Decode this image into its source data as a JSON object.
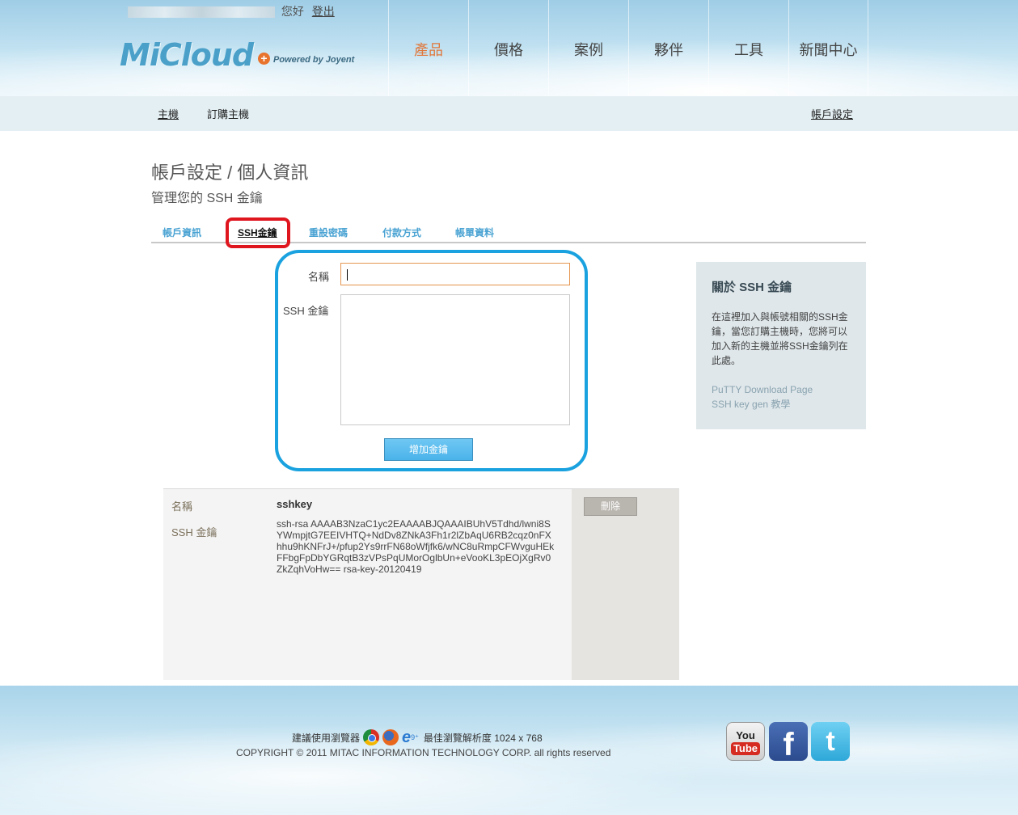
{
  "header": {
    "greeting": "您好",
    "logout": "登出",
    "logo_text": "MiCloud",
    "logo_plus": "+",
    "powered_by": "Powered by Joyent",
    "nav": [
      "產品",
      "價格",
      "案例",
      "夥伴",
      "工具",
      "新聞中心"
    ],
    "active_nav": "產品"
  },
  "subnav": {
    "hosts": "主機",
    "order_hosts": "訂購主機",
    "account_settings": "帳戶設定"
  },
  "page": {
    "title": "帳戶設定 / 個人資訊",
    "subtitle": "管理您的 SSH 金鑰"
  },
  "tabs": [
    "帳戶資訊",
    "SSH金鑰",
    "重設密碼",
    "付款方式",
    "帳單資料"
  ],
  "active_tab": "SSH金鑰",
  "form": {
    "name_label": "名稱",
    "name_value": "",
    "key_label": "SSH 金鑰",
    "key_value": "",
    "add_button": "增加金鑰"
  },
  "sidebar": {
    "heading": "關於 SSH 金鑰",
    "description": "在這裡加入與帳號相關的SSH金鑰，當您訂購主機時，您將可以加入新的主機並將SSH金鑰列在此處。",
    "links": [
      "PuTTY Download Page",
      "SSH key gen 教學"
    ]
  },
  "keys": [
    {
      "name_label": "名稱",
      "name": "sshkey",
      "key_label": "SSH 金鑰",
      "key": "ssh-rsa AAAAB3NzaC1yc2EAAAABJQAAAIBUhV5Tdhd/lwni8SYWmpjtG7EEIVHTQ+NdDv8ZNkA3Fh1r2lZbAqU6RB2cqz0nFXhhu9hKNFrJ+/pfup2Ys9rrFN68oWfjfk6/wNC8uRmpCFWvguHEkFFbgFpDbYGRqtB3zVPsPqUMorOglbUn+eVooKL3pEOjXgRv0ZkZqhVoHw== rsa-key-20120419",
      "delete_button": "刪除"
    }
  ],
  "footer": {
    "browser_text": "建議使用瀏覽器",
    "resolution_text": "最佳瀏覽解析度 1024 x 768",
    "copyright": "COPYRIGHT © 2011 MITAC INFORMATION TECHNOLOGY CORP. all rights reserved",
    "ie_version": "9⁺",
    "social": [
      "youtube-icon",
      "facebook-icon",
      "twitter-icon"
    ],
    "youtube_you": "You",
    "youtube_tube": "Tube"
  },
  "colors": {
    "accent_blue": "#19a2df",
    "highlight_red": "#e0161f",
    "nav_active": "#e0783c",
    "tab_link": "#4aa3d3"
  }
}
